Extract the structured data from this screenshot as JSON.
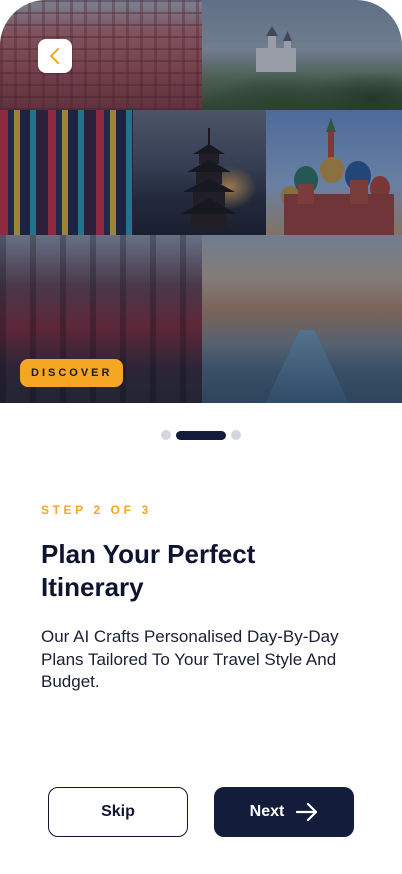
{
  "header": {
    "back_icon": "chevron-left-icon"
  },
  "hero": {
    "badge_label": "DISCOVER",
    "accent_color": "#f5a623"
  },
  "pagination": {
    "total": 3,
    "active": 2
  },
  "content": {
    "step_label": "STEP 2 OF 3",
    "title": "Plan Your Perfect Itinerary",
    "description": "Our AI Crafts Personalised Day-By-Day Plans Tailored To Your Travel Style And Budget."
  },
  "actions": {
    "skip_label": "Skip",
    "next_label": "Next",
    "next_icon": "arrow-right-icon",
    "primary_color": "#131d3b"
  }
}
